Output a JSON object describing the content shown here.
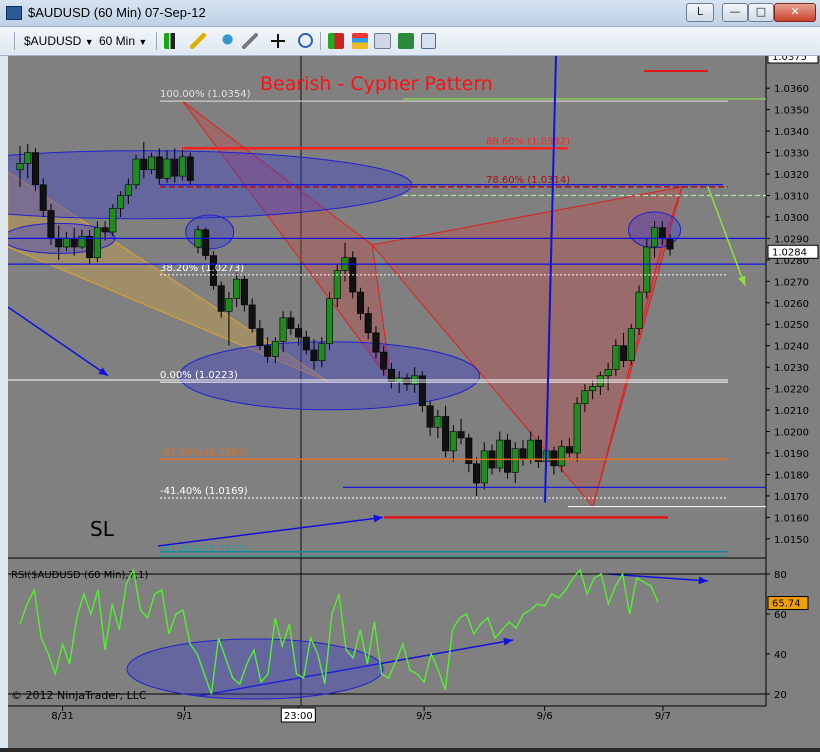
{
  "window": {
    "title": "$AUDUSD (60 Min)  07-Sep-12",
    "btn_restore": "L",
    "btn_min": "—",
    "btn_max": "□",
    "btn_close": "✕"
  },
  "toolbar": {
    "instrument": "$AUDUSD",
    "interval": "60 Min",
    "icons": [
      "bars-icon",
      "pencil-icon",
      "pushpin-icon",
      "wand-icon",
      "crosshair-icon",
      "zoom-icon",
      "chart-style-icon",
      "indicators-icon",
      "strategy-icon",
      "properties-icon"
    ]
  },
  "annotations": {
    "pattern_title": "Bearish - Cypher Pattern",
    "sl_label": "SL",
    "copyright": "© 2012 NinjaTrader, LLC",
    "fib_levels": [
      {
        "label": "100.00% (1.0354)",
        "value": 1.0354,
        "color": "#e0e0e0"
      },
      {
        "label": "88.60% (1.0332)",
        "value": 1.0332,
        "color": "#ff2020"
      },
      {
        "label": "78.60% (1.0314)",
        "value": 1.0314,
        "color": "#b01010"
      },
      {
        "label": "38.20% (1.0273)",
        "value": 1.0273,
        "color": "#ffffff"
      },
      {
        "label": "0.00% (1.0223)",
        "value": 1.0223,
        "color": "#ffffff"
      },
      {
        "label": "-27.20% (1.0187)",
        "value": 1.0187,
        "color": "#e07020"
      },
      {
        "label": "-41.40% (1.0169)",
        "value": 1.0169,
        "color": "#ffffff"
      },
      {
        "label": "-61.80% (1.0142)",
        "value": 1.0142,
        "color": "#20a0a0"
      }
    ]
  },
  "colors": {
    "background": "#808080",
    "bull": "#1f8c1f",
    "bear": "#111111",
    "price_marker": "#ffffff",
    "rsi_line": "#55ee33",
    "rsi_marker": "#f0a000",
    "accent_red": "#e01818",
    "accent_blue": "#1010e0"
  },
  "chart_data": [
    {
      "type": "candlestick",
      "title": "$AUDUSD (60 Min)",
      "ylim": [
        1.0142,
        1.0375
      ],
      "y_ticks": [
        "1.0360",
        "1.0350",
        "1.0340",
        "1.0330",
        "1.0320",
        "1.0310",
        "1.0300",
        "1.0290",
        "1.0280",
        "1.0270",
        "1.0260",
        "1.0250",
        "1.0240",
        "1.0230",
        "1.0220",
        "1.0210",
        "1.0200",
        "1.0190",
        "1.0180",
        "1.0170",
        "1.0160",
        "1.0150"
      ],
      "y_top_marker": "1.0375",
      "last_price": "1.0284",
      "x_ticks": [
        "8/31",
        "9/1",
        "23:00",
        "9/5",
        "9/6",
        "9/7"
      ],
      "candles": [
        [
          1.0322,
          1.0333,
          1.0314,
          1.0325
        ],
        [
          1.0325,
          1.0334,
          1.0318,
          1.033
        ],
        [
          1.033,
          1.0332,
          1.0312,
          1.0315
        ],
        [
          1.0315,
          1.0318,
          1.03,
          1.0303
        ],
        [
          1.0303,
          1.0306,
          1.0287,
          1.029
        ],
        [
          1.029,
          1.0296,
          1.028,
          1.0286
        ],
        [
          1.0286,
          1.0293,
          1.0284,
          1.029
        ],
        [
          1.029,
          1.0295,
          1.0282,
          1.0286
        ],
        [
          1.0286,
          1.0294,
          1.0285,
          1.0291
        ],
        [
          1.0291,
          1.0294,
          1.0278,
          1.0281
        ],
        [
          1.0281,
          1.0298,
          1.0279,
          1.0295
        ],
        [
          1.0295,
          1.0298,
          1.0289,
          1.0293
        ],
        [
          1.0293,
          1.0306,
          1.0291,
          1.0304
        ],
        [
          1.0304,
          1.0312,
          1.03,
          1.031
        ],
        [
          1.031,
          1.0318,
          1.0306,
          1.0315
        ],
        [
          1.0315,
          1.0329,
          1.0313,
          1.0327
        ],
        [
          1.0327,
          1.0335,
          1.0318,
          1.0322
        ],
        [
          1.0322,
          1.033,
          1.032,
          1.0328
        ],
        [
          1.0328,
          1.0332,
          1.0315,
          1.0318
        ],
        [
          1.0318,
          1.0331,
          1.0316,
          1.0327
        ],
        [
          1.0327,
          1.0332,
          1.0316,
          1.0319
        ],
        [
          1.0319,
          1.0331,
          1.0317,
          1.0328
        ],
        [
          1.0328,
          1.033,
          1.0315,
          1.0317
        ],
        [
          1.0286,
          1.0296,
          1.0283,
          1.0294
        ],
        [
          1.0294,
          1.0295,
          1.028,
          1.0282
        ],
        [
          1.0282,
          1.0284,
          1.0266,
          1.0268
        ],
        [
          1.0268,
          1.027,
          1.0253,
          1.0256
        ],
        [
          1.0256,
          1.0265,
          1.024,
          1.0262
        ],
        [
          1.0262,
          1.0274,
          1.0258,
          1.0271
        ],
        [
          1.0271,
          1.0273,
          1.0256,
          1.0259
        ],
        [
          1.0259,
          1.0262,
          1.0246,
          1.0248
        ],
        [
          1.0248,
          1.0252,
          1.0238,
          1.024
        ],
        [
          1.024,
          1.0244,
          1.0232,
          1.0235
        ],
        [
          1.0235,
          1.0244,
          1.0232,
          1.0242
        ],
        [
          1.0242,
          1.0256,
          1.0237,
          1.0253
        ],
        [
          1.0253,
          1.0256,
          1.0245,
          1.0248
        ],
        [
          1.0248,
          1.025,
          1.024,
          1.0244
        ],
        [
          1.0244,
          1.0247,
          1.0236,
          1.0238
        ],
        [
          1.0238,
          1.0243,
          1.0229,
          1.0233
        ],
        [
          1.0233,
          1.0244,
          1.023,
          1.0241
        ],
        [
          1.0241,
          1.0265,
          1.0238,
          1.0262
        ],
        [
          1.0262,
          1.0278,
          1.0258,
          1.0275
        ],
        [
          1.0275,
          1.0288,
          1.027,
          1.0281
        ],
        [
          1.0281,
          1.0284,
          1.0262,
          1.0265
        ],
        [
          1.0265,
          1.0267,
          1.0252,
          1.0255
        ],
        [
          1.0255,
          1.0258,
          1.0243,
          1.0246
        ],
        [
          1.0246,
          1.0249,
          1.0234,
          1.0237
        ],
        [
          1.0237,
          1.024,
          1.0226,
          1.0229
        ],
        [
          1.0229,
          1.0232,
          1.022,
          1.0223
        ],
        [
          1.0223,
          1.0228,
          1.0218,
          1.0225
        ],
        [
          1.0225,
          1.0227,
          1.0219,
          1.0222
        ],
        [
          1.0222,
          1.023,
          1.0218,
          1.0226
        ],
        [
          1.0226,
          1.0228,
          1.0209,
          1.0212
        ],
        [
          1.0212,
          1.0214,
          1.0198,
          1.0202
        ],
        [
          1.0202,
          1.021,
          1.0197,
          1.0207
        ],
        [
          1.0207,
          1.0212,
          1.0188,
          1.0191
        ],
        [
          1.0191,
          1.0203,
          1.0186,
          1.02
        ],
        [
          1.02,
          1.0206,
          1.0194,
          1.0197
        ],
        [
          1.0197,
          1.0199,
          1.0181,
          1.0185
        ],
        [
          1.0185,
          1.0188,
          1.017,
          1.0176
        ],
        [
          1.0176,
          1.0195,
          1.0173,
          1.0191
        ],
        [
          1.0191,
          1.0194,
          1.018,
          1.0183
        ],
        [
          1.0183,
          1.02,
          1.0181,
          1.0196
        ],
        [
          1.0196,
          1.0199,
          1.0178,
          1.0181
        ],
        [
          1.0181,
          1.0195,
          1.0176,
          1.0192
        ],
        [
          1.0192,
          1.0196,
          1.0184,
          1.0187
        ],
        [
          1.0187,
          1.02,
          1.0185,
          1.0196
        ],
        [
          1.0196,
          1.0198,
          1.0183,
          1.0186
        ],
        [
          1.0186,
          1.0194,
          1.0182,
          1.0191
        ],
        [
          1.0191,
          1.0193,
          1.018,
          1.0184
        ],
        [
          1.0184,
          1.0196,
          1.0181,
          1.0193
        ],
        [
          1.0193,
          1.0197,
          1.0188,
          1.019
        ],
        [
          1.019,
          1.0216,
          1.0186,
          1.0213
        ],
        [
          1.0213,
          1.0222,
          1.0209,
          1.0219
        ],
        [
          1.0219,
          1.0224,
          1.0215,
          1.0221
        ],
        [
          1.0221,
          1.0228,
          1.0217,
          1.0226
        ],
        [
          1.0226,
          1.0232,
          1.0219,
          1.0229
        ],
        [
          1.0229,
          1.0243,
          1.0226,
          1.024
        ],
        [
          1.024,
          1.0246,
          1.023,
          1.0233
        ],
        [
          1.0233,
          1.025,
          1.0231,
          1.0248
        ],
        [
          1.0248,
          1.0268,
          1.0245,
          1.0265
        ],
        [
          1.0265,
          1.029,
          1.0262,
          1.0286
        ],
        [
          1.0286,
          1.0298,
          1.0281,
          1.0295
        ],
        [
          1.0295,
          1.0298,
          1.0287,
          1.029
        ],
        [
          1.029,
          1.0292,
          1.0282,
          1.0285
        ]
      ]
    },
    {
      "type": "line",
      "title": "RSI($AUDUSD (60 Min),7,1)",
      "ylim": [
        14,
        86
      ],
      "y_ticks": [
        "80",
        "60",
        "40",
        "20"
      ],
      "last_value": "65.74",
      "series": [
        {
          "name": "RSI($AUDUSD (60 Min),7,1)",
          "values": [
            55,
            65,
            72,
            48,
            40,
            30,
            45,
            35,
            58,
            70,
            60,
            72,
            42,
            65,
            52,
            75,
            82,
            62,
            58,
            70,
            72,
            50,
            60,
            62,
            45,
            40,
            30,
            20,
            48,
            38,
            28,
            25,
            35,
            42,
            26,
            30,
            58,
            44,
            55,
            30,
            28,
            48,
            40,
            25,
            60,
            70,
            42,
            38,
            52,
            35,
            56,
            30,
            28,
            36,
            45,
            32,
            30,
            26,
            40,
            32,
            22,
            52,
            58,
            60,
            50,
            55,
            58,
            48,
            52,
            56,
            53,
            60,
            62,
            65,
            64,
            70,
            68,
            72,
            78,
            82,
            70,
            78,
            80,
            65,
            74,
            80,
            60,
            78,
            76,
            74,
            66
          ]
        }
      ]
    }
  ]
}
